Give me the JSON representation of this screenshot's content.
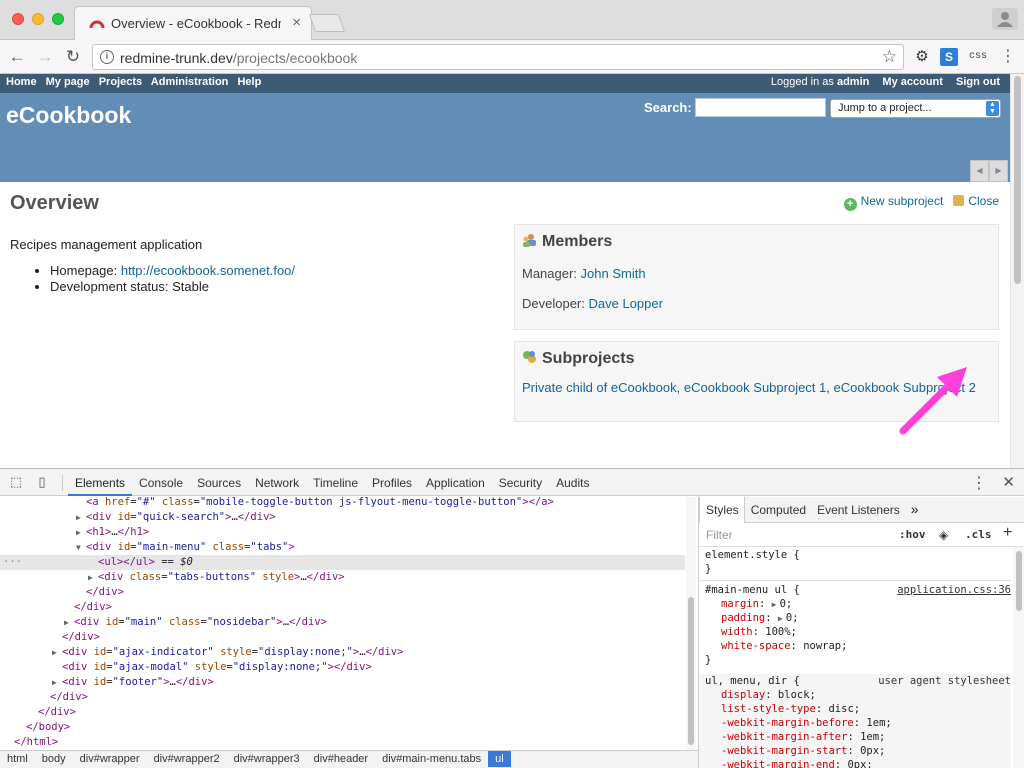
{
  "browser": {
    "tab_title": "Overview - eCookbook - Redm",
    "tab_close": "×",
    "url_host": "redmine-trunk.dev",
    "url_path": "/projects/ecookbook",
    "ext_css": "css",
    "ext_s": "S"
  },
  "top_menu": {
    "left": [
      "Home",
      "My page",
      "Projects",
      "Administration",
      "Help"
    ],
    "logged_as": "Logged in as",
    "user": "admin",
    "my_account": "My account",
    "sign_out": "Sign out"
  },
  "header": {
    "project_title": "eCookbook",
    "search_label": "Search:",
    "search_value": "",
    "jump_placeholder": "Jump to a project..."
  },
  "content": {
    "heading": "Overview",
    "new_subproject": "New subproject",
    "close": "Close",
    "description": "Recipes management application",
    "homepage_label": "Homepage:",
    "homepage_url": "http://ecookbook.somenet.foo/",
    "status_label": "Development status:",
    "status_value": "Stable",
    "members": {
      "title": "Members",
      "manager_label": "Manager:",
      "manager": "John Smith",
      "developer_label": "Developer:",
      "developer": "Dave Lopper"
    },
    "subprojects": {
      "title": "Subprojects",
      "items": [
        "Private child of eCookbook",
        "eCookbook Subproject 1",
        "eCookbook Subproject 2"
      ]
    }
  },
  "devtools": {
    "tabs": [
      "Elements",
      "Console",
      "Sources",
      "Network",
      "Timeline",
      "Profiles",
      "Application",
      "Security",
      "Audits"
    ],
    "active_tab": "Elements",
    "breadcrumbs": [
      "html",
      "body",
      "div#wrapper",
      "div#wrapper2",
      "div#wrapper3",
      "div#header",
      "div#main-menu.tabs",
      "ul"
    ],
    "styles_tabs": [
      "Styles",
      "Computed",
      "Event Listeners"
    ],
    "filter_placeholder": "Filter",
    "hov": ":hov",
    "cls": ".cls",
    "element_style": "element.style {",
    "rule_selector": "#main-menu ul {",
    "rule_source": "application.css:36",
    "rule_props": [
      {
        "name": "margin",
        "value": "0;"
      },
      {
        "name": "padding",
        "value": "0;"
      },
      {
        "name": "width",
        "value": "100%;"
      },
      {
        "name": "white-space",
        "value": "nowrap;"
      }
    ],
    "ua_selector": "ul, menu, dir {",
    "ua_source": "user agent stylesheet",
    "ua_props": [
      {
        "name": "display",
        "value": "block;"
      },
      {
        "name": "list-style-type",
        "value": "disc;"
      },
      {
        "name": "-webkit-margin-before",
        "value": "1em;"
      },
      {
        "name": "-webkit-margin-after",
        "value": "1em;"
      },
      {
        "name": "-webkit-margin-start",
        "value": "0px;"
      },
      {
        "name": "-webkit-margin-end",
        "value": "0px;"
      }
    ]
  }
}
